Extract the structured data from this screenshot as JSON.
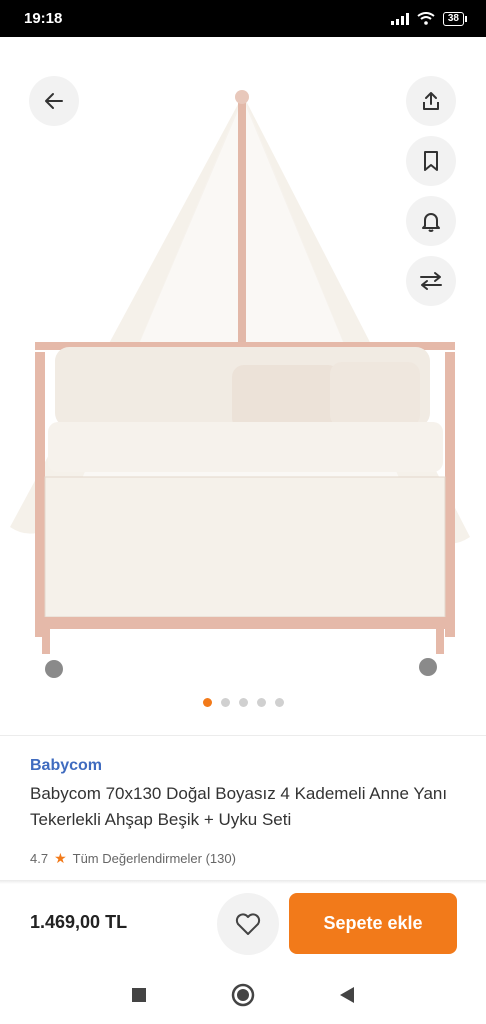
{
  "status_bar": {
    "time": "19:18",
    "battery": "38"
  },
  "product": {
    "brand": "Babycom",
    "title": "Babycom 70x130 Doğal Boyasız 4 Kademeli Anne Yanı Tekerlekli Ahşap Beşik + Uyku Seti",
    "rating": "4.7",
    "reviews_label": "Tüm Değerlendirmeler (130)",
    "price": "1.469,00 TL"
  },
  "gallery": {
    "total_images": 5,
    "active_index": 0
  },
  "actions": {
    "add_to_cart_label": "Sepete ekle"
  },
  "colors": {
    "accent": "#f27a1a",
    "brand_link": "#3f6bbf"
  },
  "icons": [
    "back-arrow-icon",
    "share-icon",
    "bookmark-icon",
    "bell-icon",
    "compare-icon",
    "heart-icon",
    "star-icon",
    "nav-square-icon",
    "nav-circle-icon",
    "nav-back-triangle-icon"
  ]
}
